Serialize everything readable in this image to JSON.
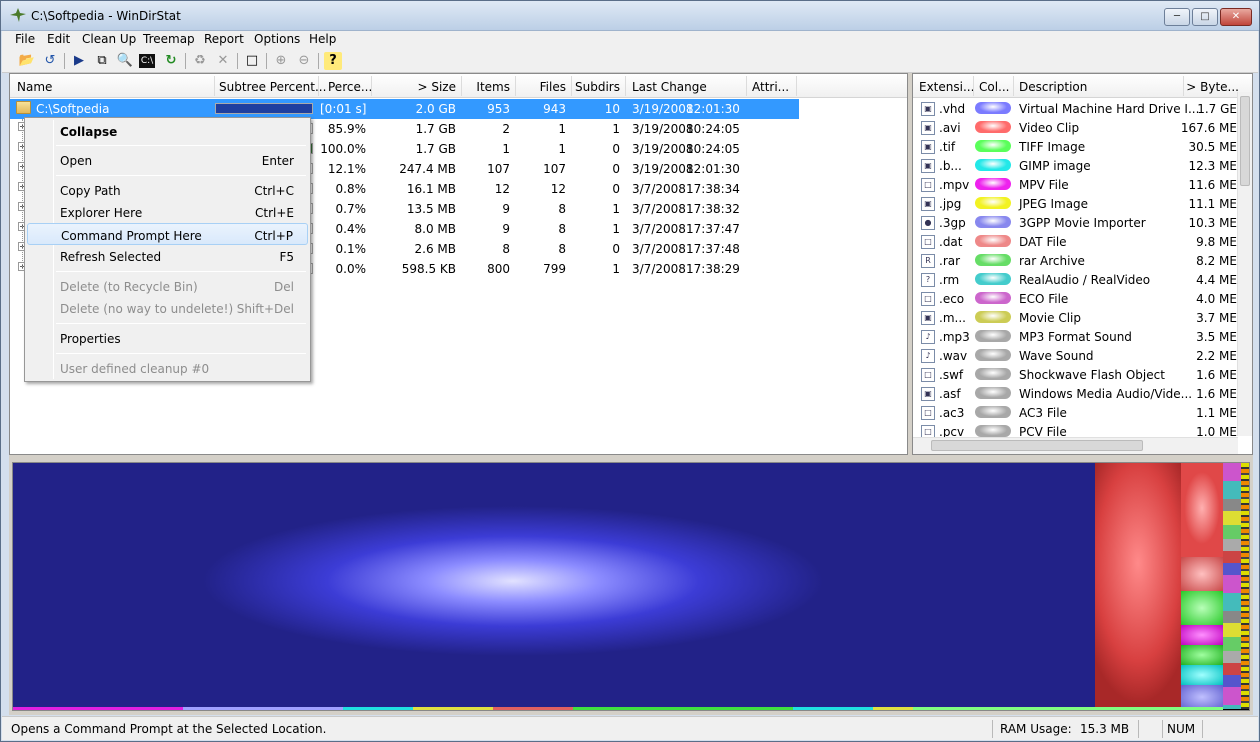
{
  "window": {
    "title": "C:\\Softpedia - WinDirStat"
  },
  "menu": [
    "File",
    "Edit",
    "Clean Up",
    "Treemap",
    "Report",
    "Options",
    "Help"
  ],
  "toolbar_icons": [
    "open-icon",
    "refresh-icon",
    "play-icon",
    "copy-icon",
    "explorer-icon",
    "cmd-icon",
    "refresh-selected-icon",
    "recycle-icon",
    "delete-icon",
    "properties-icon",
    "zoom-in-icon",
    "zoom-out-icon",
    "help-icon"
  ],
  "tree": {
    "headers": {
      "name": "Name",
      "subtree": "Subtree Percent...",
      "perc": "Perce...",
      "size": "> Size",
      "items": "Items",
      "files": "Files",
      "subdirs": "Subdirs",
      "last_change": "Last Change",
      "attri": "Attri..."
    },
    "rows": [
      {
        "name": "C:\\Softpedia",
        "perc": "[0:01 s]",
        "size": "2.0 GB",
        "items": "953",
        "files": "943",
        "subdirs": "10",
        "date": "3/19/2008",
        "time": "12:01:30",
        "bar": 1.0
      },
      {
        "name": "",
        "perc": "85.9%",
        "size": "1.7 GB",
        "items": "2",
        "files": "1",
        "subdirs": "1",
        "date": "3/19/2008",
        "time": "10:24:05",
        "bar": 0.859
      },
      {
        "name": "",
        "perc": "100.0%",
        "size": "1.7 GB",
        "items": "1",
        "files": "1",
        "subdirs": "0",
        "date": "3/19/2008",
        "time": "10:24:05",
        "bar": 1.0
      },
      {
        "name": "",
        "perc": "12.1%",
        "size": "247.4 MB",
        "items": "107",
        "files": "107",
        "subdirs": "0",
        "date": "3/19/2008",
        "time": "12:01:30",
        "bar": 0.121
      },
      {
        "name": "",
        "perc": "0.8%",
        "size": "16.1 MB",
        "items": "12",
        "files": "12",
        "subdirs": "0",
        "date": "3/7/2008",
        "time": "17:38:34",
        "bar": 0.008
      },
      {
        "name": "",
        "perc": "0.7%",
        "size": "13.5 MB",
        "items": "9",
        "files": "8",
        "subdirs": "1",
        "date": "3/7/2008",
        "time": "17:38:32",
        "bar": 0.007
      },
      {
        "name": "",
        "perc": "0.4%",
        "size": "8.0 MB",
        "items": "9",
        "files": "8",
        "subdirs": "1",
        "date": "3/7/2008",
        "time": "17:37:47",
        "bar": 0.004
      },
      {
        "name": "",
        "perc": "0.1%",
        "size": "2.6 MB",
        "items": "8",
        "files": "8",
        "subdirs": "0",
        "date": "3/7/2008",
        "time": "17:37:48",
        "bar": 0.001
      },
      {
        "name": "",
        "perc": "0.0%",
        "size": "598.5 KB",
        "items": "800",
        "files": "799",
        "subdirs": "1",
        "date": "3/7/2008",
        "time": "17:38:29",
        "bar": 0.0
      }
    ]
  },
  "context_menu": {
    "collapse": "Collapse",
    "open": "Open",
    "open_key": "Enter",
    "copy_path": "Copy Path",
    "copy_path_key": "Ctrl+C",
    "explorer": "Explorer Here",
    "explorer_key": "Ctrl+E",
    "cmd": "Command Prompt Here",
    "cmd_key": "Ctrl+P",
    "refresh": "Refresh Selected",
    "refresh_key": "F5",
    "del_recycle": "Delete (to Recycle Bin)",
    "del_recycle_key": "Del",
    "del_perm": "Delete (no way to undelete!)",
    "del_perm_key": "Shift+Del",
    "properties": "Properties",
    "user_cleanup": "User defined cleanup #0"
  },
  "extensions": {
    "headers": {
      "ext": "Extensi...",
      "color": "Col...",
      "desc": "Description",
      "bytes": "> Byte..."
    },
    "rows": [
      {
        "ext": ".vhd",
        "color": "#7b7bff",
        "desc": "Virtual Machine Hard Drive I...",
        "bytes": "1.7 GE"
      },
      {
        "ext": ".avi",
        "color": "#ff6b6b",
        "desc": "Video Clip",
        "bytes": "167.6 ME"
      },
      {
        "ext": ".tif",
        "color": "#5aff5a",
        "desc": "TIFF Image",
        "bytes": "30.5 ME"
      },
      {
        "ext": ".b...",
        "color": "#22e8e8",
        "desc": "GIMP image",
        "bytes": "12.3 ME"
      },
      {
        "ext": ".mpv",
        "color": "#ee22ee",
        "desc": "MPV File",
        "bytes": "11.6 ME"
      },
      {
        "ext": ".jpg",
        "color": "#f2f222",
        "desc": "JPEG Image",
        "bytes": "11.1 ME"
      },
      {
        "ext": ".3gp",
        "color": "#8888ee",
        "desc": "3GPP Movie Importer",
        "bytes": "10.3 ME"
      },
      {
        "ext": ".dat",
        "color": "#ee8888",
        "desc": "DAT File",
        "bytes": "9.8 ME"
      },
      {
        "ext": ".rar",
        "color": "#66dd66",
        "desc": "rar Archive",
        "bytes": "8.2 ME"
      },
      {
        "ext": ".rm",
        "color": "#44cccc",
        "desc": "RealAudio / RealVideo",
        "bytes": "4.4 ME"
      },
      {
        "ext": ".eco",
        "color": "#cc66cc",
        "desc": "ECO File",
        "bytes": "4.0 ME"
      },
      {
        "ext": ".m...",
        "color": "#cccc55",
        "desc": "Movie Clip",
        "bytes": "3.7 ME"
      },
      {
        "ext": ".mp3",
        "color": "#a8a8a8",
        "desc": "MP3 Format Sound",
        "bytes": "3.5 ME"
      },
      {
        "ext": ".wav",
        "color": "#a8a8a8",
        "desc": "Wave Sound",
        "bytes": "2.2 ME"
      },
      {
        "ext": ".swf",
        "color": "#a8a8a8",
        "desc": "Shockwave Flash Object",
        "bytes": "1.6 ME"
      },
      {
        "ext": ".asf",
        "color": "#a8a8a8",
        "desc": "Windows Media Audio/Vide...",
        "bytes": "1.6 ME"
      },
      {
        "ext": ".ac3",
        "color": "#a8a8a8",
        "desc": "AC3 File",
        "bytes": "1.1 ME"
      },
      {
        "ext": ".pcv",
        "color": "#a8a8a8",
        "desc": "PCV File",
        "bytes": "1.0 ME"
      }
    ]
  },
  "status": {
    "message": "Opens a Command Prompt at the Selected Location.",
    "ram_label": "RAM Usage:",
    "ram_value": "15.3 MB",
    "num": "NUM"
  }
}
